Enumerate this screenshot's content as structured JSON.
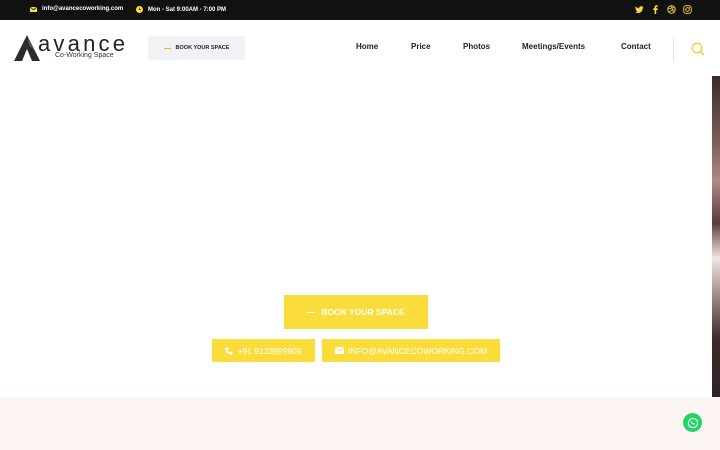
{
  "topbar": {
    "email": "info@avancecoworking.com",
    "hours": "Mon - Sat 9:00AM - 7:00 PM",
    "social": [
      "twitter-icon",
      "facebook-icon",
      "dribbble-icon",
      "instagram-icon"
    ]
  },
  "logo": {
    "name": "avance",
    "tagline": "Co-Working Space"
  },
  "header": {
    "book_label": "BOOK YOUR SPACE"
  },
  "nav": {
    "items": [
      {
        "label": "Home"
      },
      {
        "label": "Price"
      },
      {
        "label": "Photos"
      },
      {
        "label": "Meetings/Events"
      },
      {
        "label": "Contact"
      }
    ]
  },
  "hero": {
    "book_label": "BOOK YOUR SPACE",
    "phone": "+91 9133999909",
    "email": "INFO@AVANCECOWORKING.COM"
  },
  "colors": {
    "accent": "#fadc3a",
    "topbar": "#111111",
    "band": "#fdf4f4",
    "whatsapp": "#25d366"
  }
}
